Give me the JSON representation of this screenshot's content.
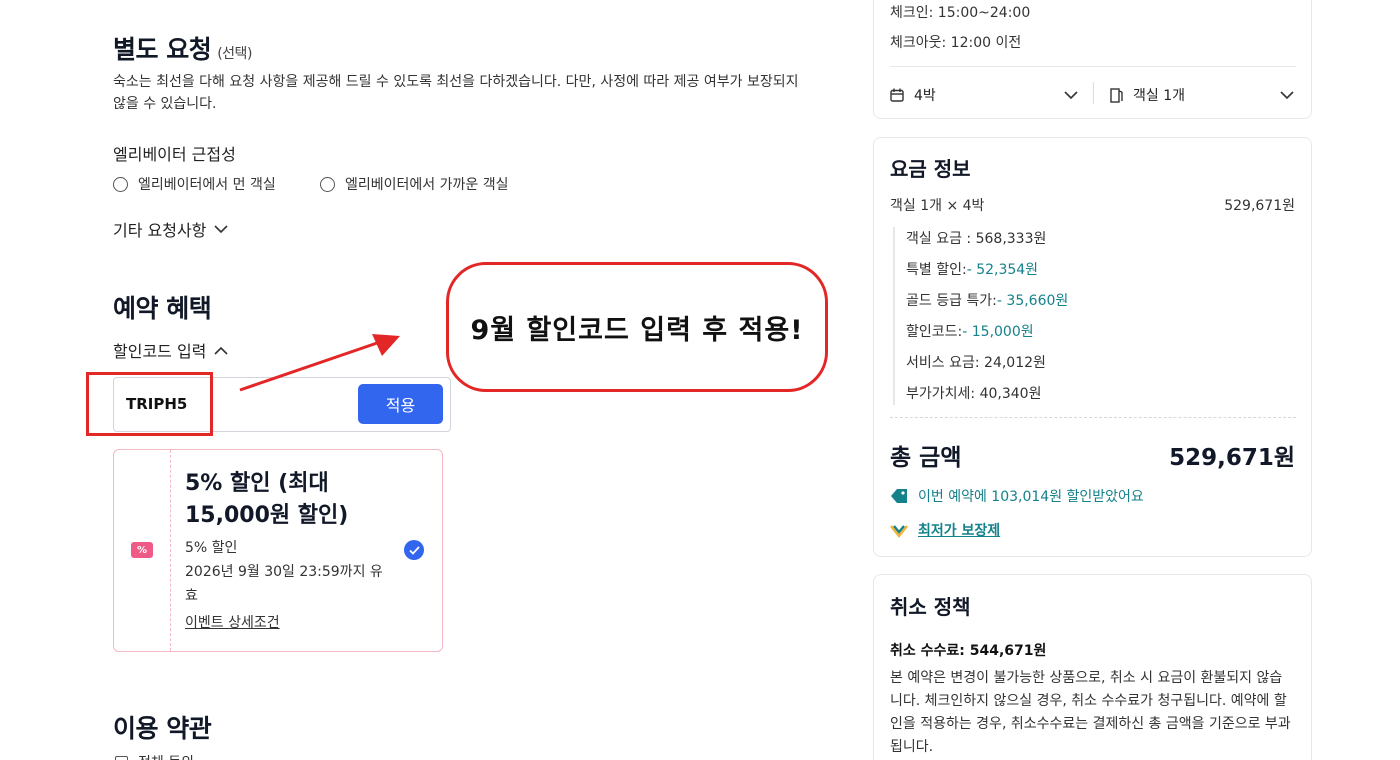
{
  "special_request": {
    "title": "별도 요청",
    "optional_tag": "(선택)",
    "description_line1": "숙소는 최선을 다해 요청 사항을 제공해 드릴 수 있도록 최선을 다하겠습니다. 다만, 사정에 따라 제공 여부가 보장되지",
    "description_line2": "않을 수 있습니다.",
    "elevator_heading": "엘리베이터 근접성",
    "elevator_options": [
      "엘리베이터에서 먼 객실",
      "엘리베이터에서 가까운 객실"
    ],
    "other_requests": "기타 요청사항"
  },
  "benefits": {
    "title": "예약 혜택",
    "code_toggle": "할인코드 입력",
    "code_value": "TRIPH5",
    "apply_label": "적용",
    "coupon": {
      "icon_text": "%",
      "title_line1": "5% 할인 (최대",
      "title_line2": "15,000원 할인)",
      "subtitle": "5% 할인",
      "validity_line1": "2026년 9월 30일 23:59까지 유",
      "validity_line2": "효",
      "details_link": "이벤트 상세조건"
    }
  },
  "annotation": {
    "callout_text": "9월 할인코드 입력 후 적용!"
  },
  "terms": {
    "title": "이용 약관",
    "agree_all": "전체 동의"
  },
  "stay": {
    "checkin": "체크인: 15:00~24:00",
    "checkout": "체크아웃: 12:00 이전",
    "nights": "4박",
    "rooms": "객실 1개"
  },
  "price_info": {
    "title": "요금 정보",
    "summary_label": "객실 1개 × 4박",
    "summary_value": "529,671원",
    "room_rate_label": "객실 요금 : ",
    "room_rate_value": "568,333원",
    "special_discount_label": "특별 할인:",
    "special_discount_value": "- 52,354원",
    "gold_label": "골드 등급 특가:",
    "gold_value": "- 35,660원",
    "code_label": "할인코드:",
    "code_value": "- 15,000원",
    "service_label": "서비스 요금: ",
    "service_value": "24,012원",
    "vat_label": "부가가치세: ",
    "vat_value": "40,340원",
    "total_label": "총 금액",
    "total_value": "529,671원",
    "savings_text": "이번 예약에 103,014원 할인받았어요",
    "best_price": "최저가 보장제"
  },
  "cancellation": {
    "title": "취소 정책",
    "fee_label": "취소 수수료: 544,671원",
    "body_line1": "본 예약은 변경이 불가능한 상품으로, 취소 시 요금이 환불되지 않습",
    "body_line2": "니다. 체크인하지 않으실 경우, 취소 수수료가 청구됩니다. 예약에 할",
    "body_line3": "인을 적용하는 경우, 취소수수료는 결제하신 총 금액을 기준으로 부과",
    "body_line4": "됩니다."
  },
  "colors": {
    "accent_blue": "#3366ee",
    "annotation_red": "#e32626",
    "teal": "#15818a",
    "coupon_pink": "#f05a86"
  }
}
